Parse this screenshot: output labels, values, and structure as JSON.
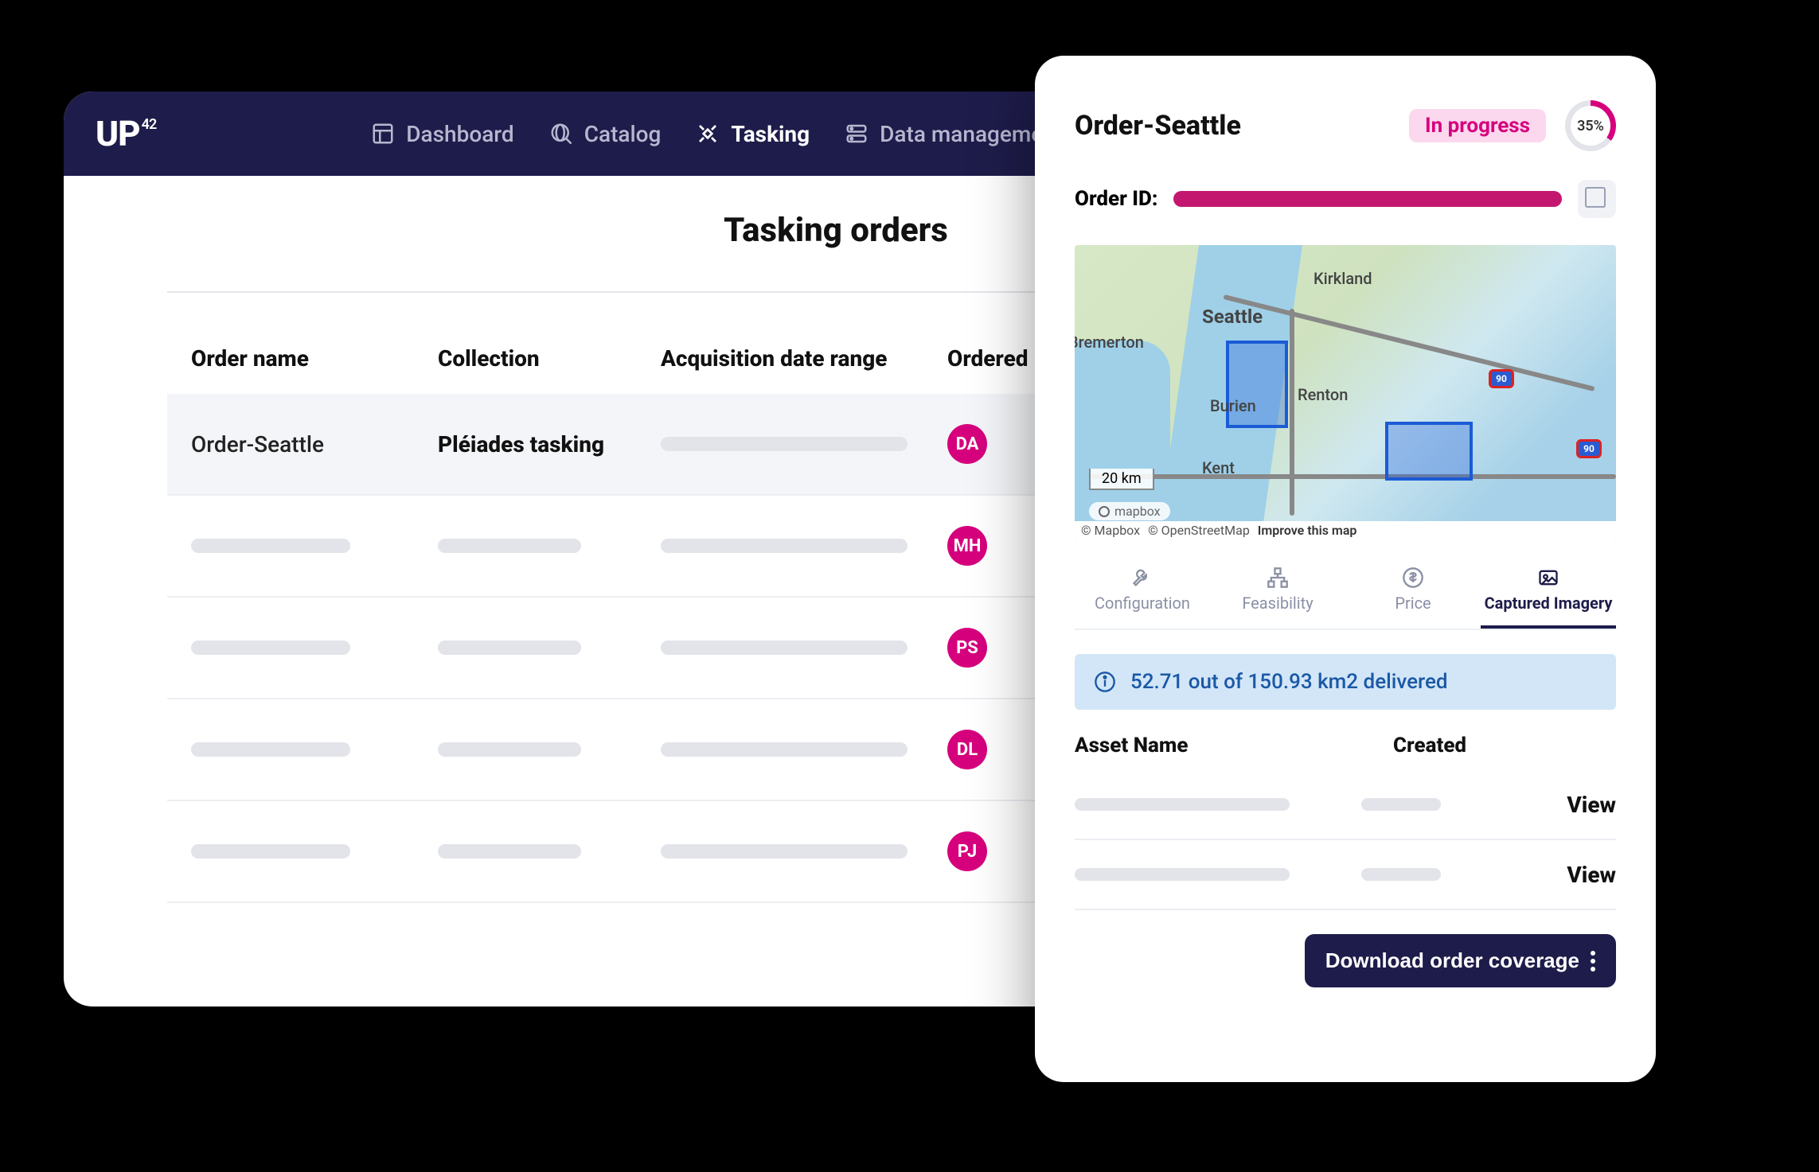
{
  "brand": {
    "name": "UP",
    "super": "42"
  },
  "nav": {
    "dashboard": "Dashboard",
    "catalog": "Catalog",
    "tasking": "Tasking",
    "data_management": "Data management"
  },
  "page": {
    "title": "Tasking orders"
  },
  "table": {
    "headers": {
      "order_name": "Order name",
      "collection": "Collection",
      "acq_range": "Acquisition date range",
      "ordered": "Ordered"
    },
    "rows": [
      {
        "order_name": "Order-Seattle",
        "collection": "Pléiades tasking",
        "initials": "DA",
        "highlight": true
      },
      {
        "initials": "MH"
      },
      {
        "initials": "PS"
      },
      {
        "initials": "DL"
      },
      {
        "initials": "PJ"
      }
    ]
  },
  "panel": {
    "title": "Order-Seattle",
    "status": "In progress",
    "progress_pct": "35%",
    "order_id_label": "Order ID:",
    "map": {
      "city_seattle": "Seattle",
      "city_kirkland": "Kirkland",
      "city_bremerton": "Bremerton",
      "city_burien": "Burien",
      "city_renton": "Renton",
      "city_kent": "Kent",
      "scale": "20 km",
      "mapbox_badge": "mapbox",
      "attrib_mapbox": "© Mapbox",
      "attrib_osm": "© OpenStreetMap",
      "attrib_improve": "Improve this map",
      "hwy1": "90",
      "hwy2": "90"
    },
    "tabs": {
      "configuration": "Configuration",
      "feasibility": "Feasibility",
      "price": "Price",
      "captured": "Captured Imagery"
    },
    "banner": "52.71 out of 150.93 km2 delivered",
    "assets": {
      "header_name": "Asset Name",
      "header_created": "Created",
      "view": "View"
    },
    "download_btn": "Download order coverage"
  }
}
